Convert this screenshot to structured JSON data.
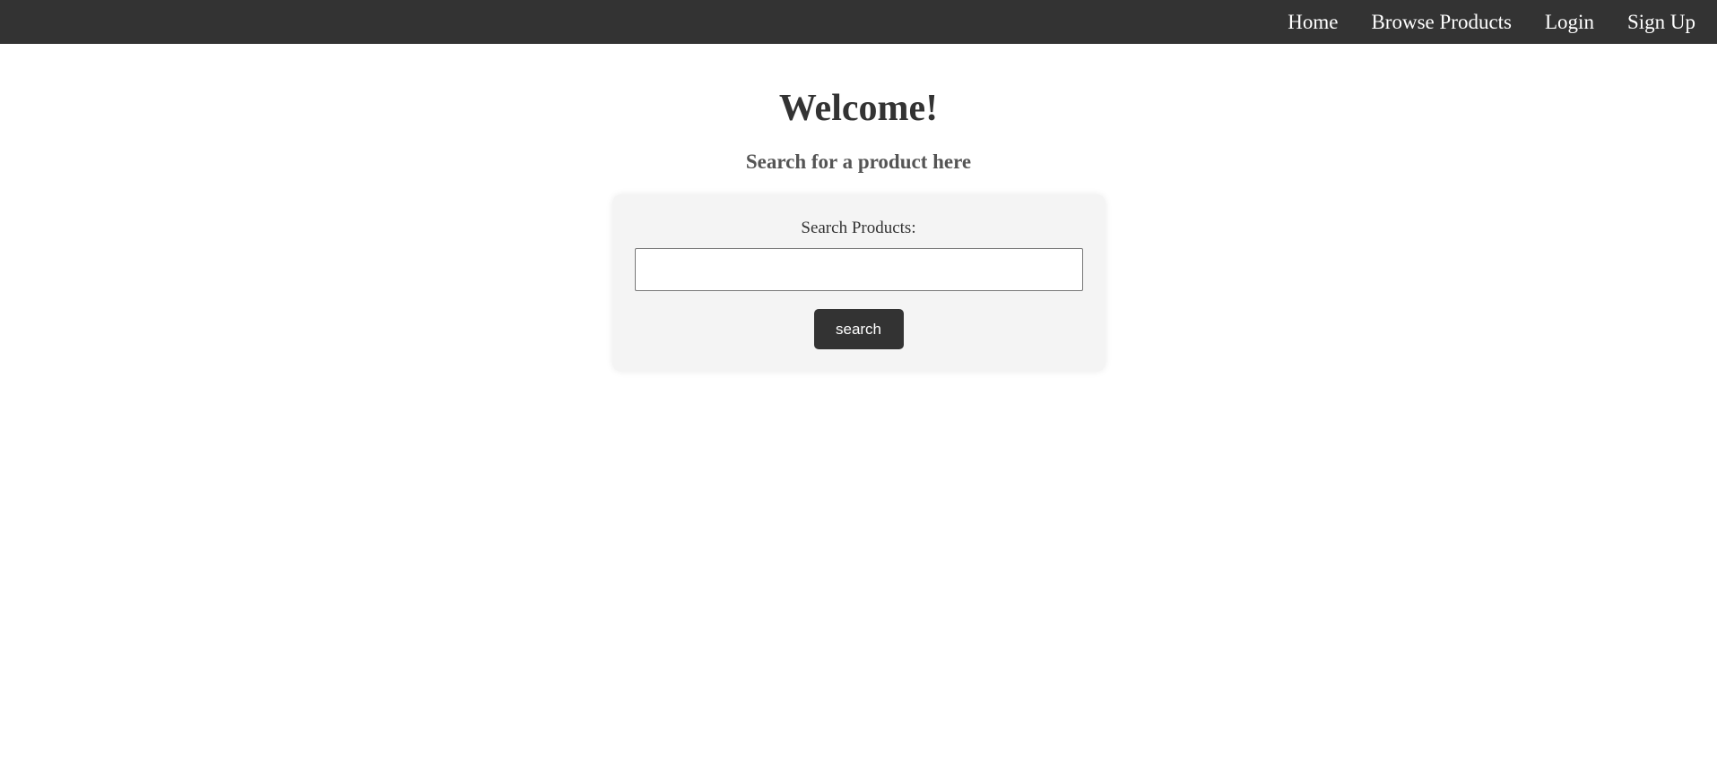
{
  "nav": {
    "items": [
      {
        "label": "Home"
      },
      {
        "label": "Browse Products"
      },
      {
        "label": "Login"
      },
      {
        "label": "Sign Up"
      }
    ]
  },
  "main": {
    "title": "Welcome!",
    "subtitle": "Search for a product here",
    "search": {
      "label": "Search Products:",
      "value": "",
      "placeholder": "",
      "button_label": "search"
    }
  },
  "colors": {
    "navbar_bg": "#333333",
    "card_bg": "#f4f4f4",
    "button_bg": "#333333"
  }
}
